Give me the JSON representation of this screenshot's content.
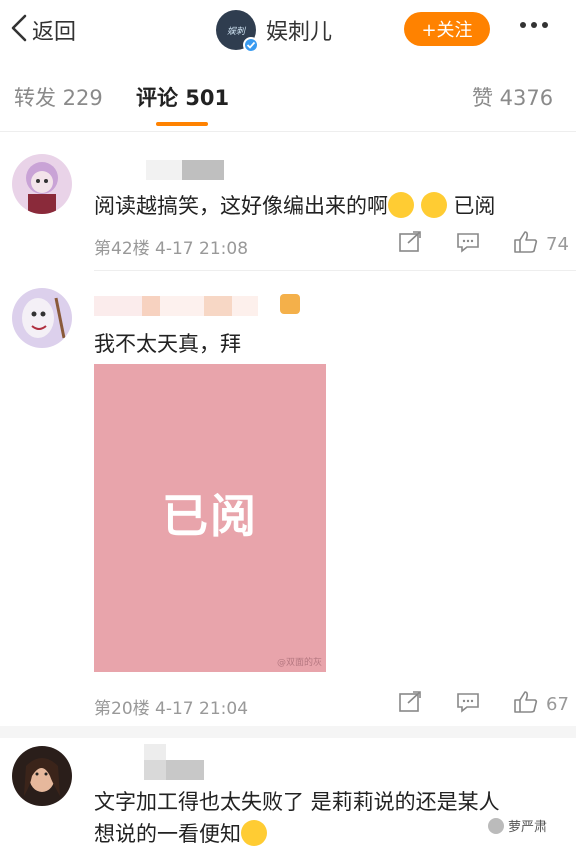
{
  "nav": {
    "back_label": "返回",
    "brand_logo_text": "娱刺",
    "brand_name": "娱刺儿",
    "follow_label": "+关注"
  },
  "tabs": {
    "repost": "转发 229",
    "comments": "评论 501",
    "likes": "赞 4376"
  },
  "comments": [
    {
      "text": "阅读越搞笑，这好像编出来的啊",
      "text_tail": "已阅",
      "floor_time": "第42楼  4-17  21:08",
      "likes": "74"
    },
    {
      "text": "我不太天真，拜",
      "image_text": "已阅",
      "image_watermark": "@双面的灰",
      "floor_time": "第20楼  4-17  21:04",
      "likes": "67"
    },
    {
      "text_line1": "文字加工得也太失败了 是莉莉说的还是某人",
      "text_line2": "想说的一看便知"
    }
  ],
  "watermark": "萝严肃",
  "colors": {
    "accent": "#ff8200",
    "pink_card": "#e8a4ab",
    "verified": "#3a9bf0"
  }
}
